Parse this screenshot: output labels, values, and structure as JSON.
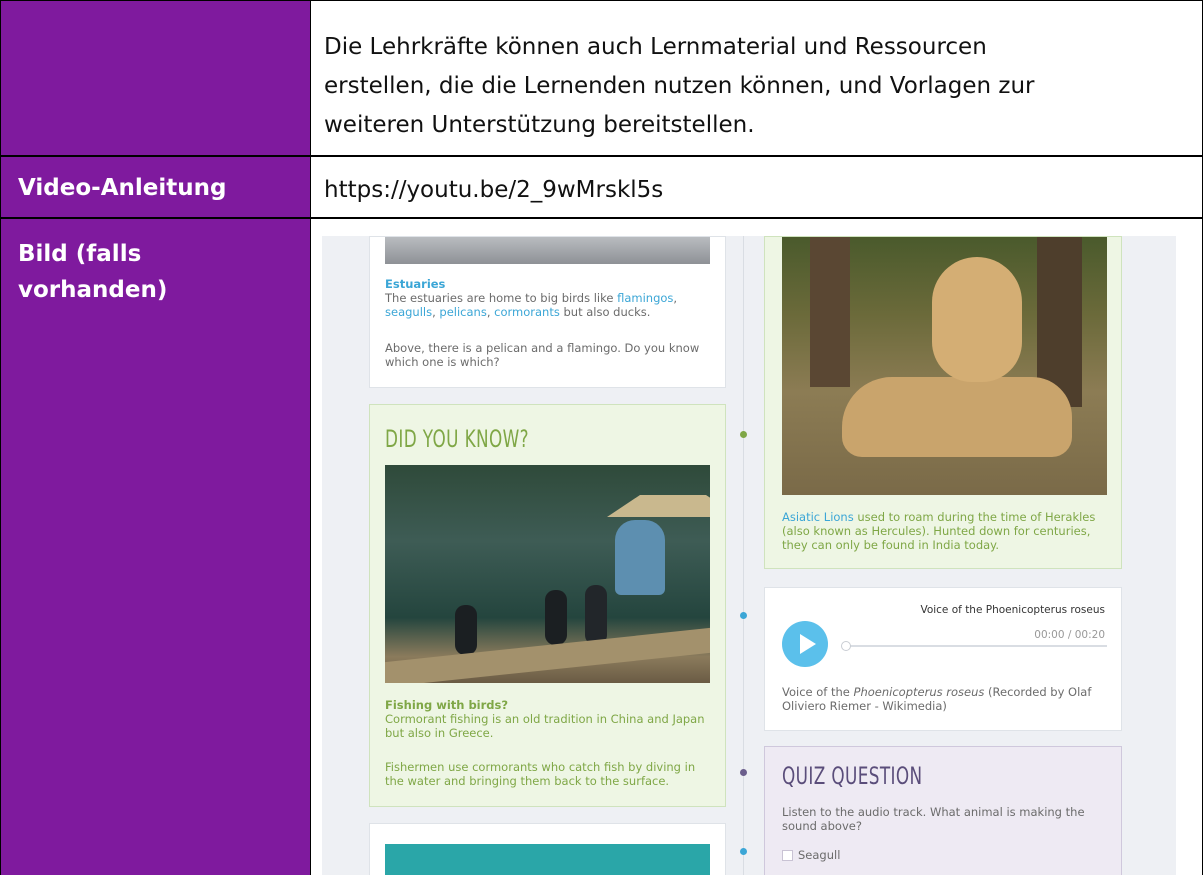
{
  "table": {
    "row1_text": "Die Lehrkräfte können auch Lernmaterial und Ressourcen erstellen, die die Lernenden nutzen können, und Vorlagen zur weiteren Unterstützung bereitstellen.",
    "row1_lines": [
      "Die Lehrkräfte können auch Lernmaterial und Ressourcen",
      "erstellen, die die Lernenden nutzen können, und Vorlagen zur",
      "weiteren Unterstützung bereitstellen."
    ],
    "video_label": "Video-Anleitung",
    "video_url": "https://youtu.be/2_9wMrskl5s",
    "image_label_line1": "Bild (falls",
    "image_label_line2": "vorhanden)"
  },
  "screenshot": {
    "estuaries": {
      "title": "Estuaries",
      "text_a": "The estuaries are home to big birds like ",
      "link_flamingos": "flamingos",
      "link_seagulls": "seagulls",
      "link_pelicans": "pelicans",
      "link_cormorants": "cormorants",
      "text_b": " but also ducks.",
      "question": "Above, there is a pelican and a flamingo. Do you know which one is which?"
    },
    "did_you_know": {
      "heading": "DID YOU KNOW?",
      "caption_title": "Fishing with birds?",
      "caption_1": "Cormorant fishing is an old tradition in China and Japan but also in Greece.",
      "caption_2": "Fishermen use cormorants who catch fish by diving in the water and bringing them back to the surface."
    },
    "lions": {
      "link": "Asiatic Lions",
      "text": " used to roam during the time of Herakles (also known as Hercules). Hunted down for centuries, they can only be found in India today."
    },
    "audio": {
      "title": "Voice of the Phoenicopterus roseus",
      "time": "00:00 / 00:20",
      "caption_a": "Voice of the ",
      "caption_italic": "Phoenicopterus roseus",
      "caption_b": " (Recorded by Olaf Oliviero Riemer - Wikimedia)",
      "progress": 0
    },
    "quiz": {
      "heading": "QUIZ QUESTION",
      "question": "Listen to the audio track. What animal is making the sound above?",
      "option1": "Seagull"
    }
  },
  "colors": {
    "label_bg": "#7f1a9e",
    "link": "#3ba6d6",
    "green_text": "#7fa746",
    "quiz_heading": "#5a4d7a"
  }
}
